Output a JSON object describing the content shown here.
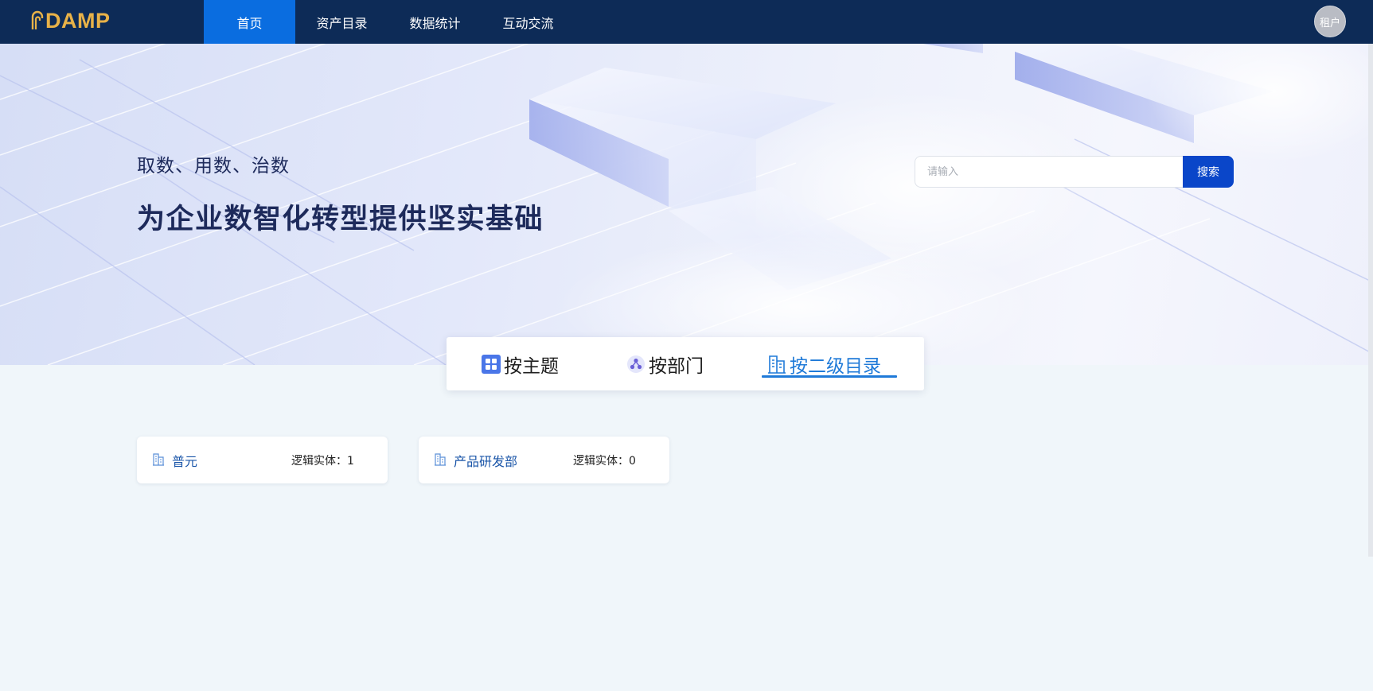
{
  "brand": {
    "logo_text": "DAMP",
    "logo_color": "#e8b248"
  },
  "nav": {
    "items": [
      {
        "label": "首页",
        "active": true
      },
      {
        "label": "资产目录",
        "active": false
      },
      {
        "label": "数据统计",
        "active": false
      },
      {
        "label": "互动交流",
        "active": false
      }
    ],
    "bg_color": "#0d2b57",
    "active_color": "#0a6de0"
  },
  "user": {
    "avatar_label": "租户"
  },
  "hero": {
    "subtitle": "取数、用数、治数",
    "title": "为企业数智化转型提供坚实基础"
  },
  "search": {
    "placeholder": "请输入",
    "value": "",
    "button_label": "搜索"
  },
  "tabs": {
    "items": [
      {
        "label": "按主题",
        "icon": "grid-icon",
        "active": false
      },
      {
        "label": "按部门",
        "icon": "org-icon",
        "active": false
      },
      {
        "label": "按二级目录",
        "icon": "building-icon",
        "active": true
      }
    ],
    "active_color": "#1f7ad8"
  },
  "cards": [
    {
      "name": "普元",
      "count_label": "逻辑实体：",
      "count": "1",
      "icon": "building-icon"
    },
    {
      "name": "产品研发部",
      "count_label": "逻辑实体：",
      "count": "0",
      "icon": "building-icon"
    }
  ]
}
